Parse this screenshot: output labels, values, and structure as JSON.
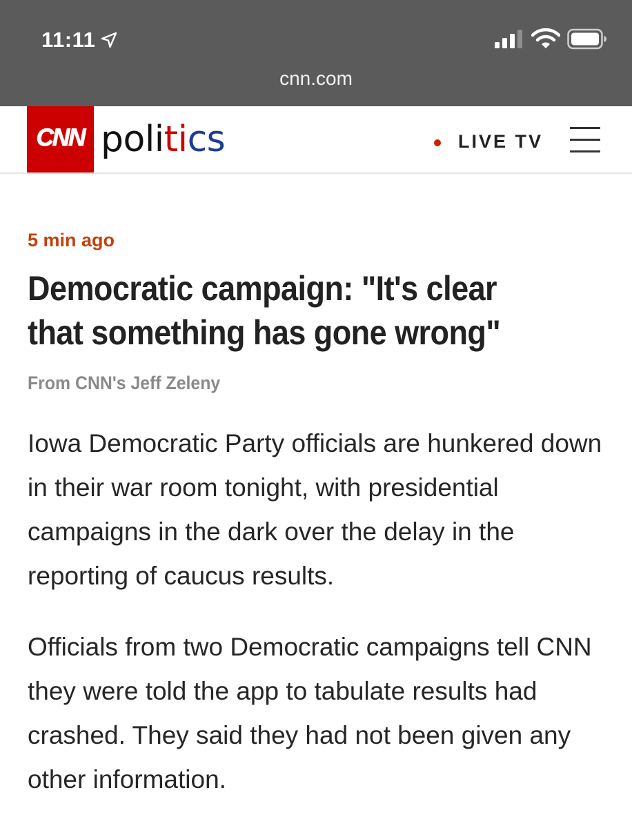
{
  "status_bar": {
    "time": "11:11",
    "icons": [
      "location-arrow-icon",
      "cellular-signal-icon",
      "wifi-icon",
      "battery-icon"
    ]
  },
  "browser": {
    "url": "cnn.com"
  },
  "site_header": {
    "logo_text": "CNN",
    "section": {
      "part1": "poli",
      "part2": "ti",
      "part3": "cs"
    },
    "live_tv_label": "LIVE TV",
    "menu_icon": "hamburger-menu-icon"
  },
  "article": {
    "timestamp": "5 min ago",
    "headline": "Democratic campaign: \"It's clear that something has gone wrong\"",
    "byline": "From CNN's Jeff Zeleny",
    "paragraphs": [
      "Iowa Democratic Party officials are hunkered down in their war room tonight, with presidential campaigns in the dark over the delay in the reporting of caucus results.",
      "Officials from two Democratic campaigns tell CNN they were told the app to tabulate results had crashed. They said they had not been given any other information."
    ]
  },
  "colors": {
    "status_bar_bg": "#5b5b5b",
    "brand_red": "#cc0000",
    "timestamp_orange": "#c2410c",
    "politics_blue": "#1d3d8f",
    "headline_text": "#222222",
    "byline_gray": "#8a8a8a"
  }
}
